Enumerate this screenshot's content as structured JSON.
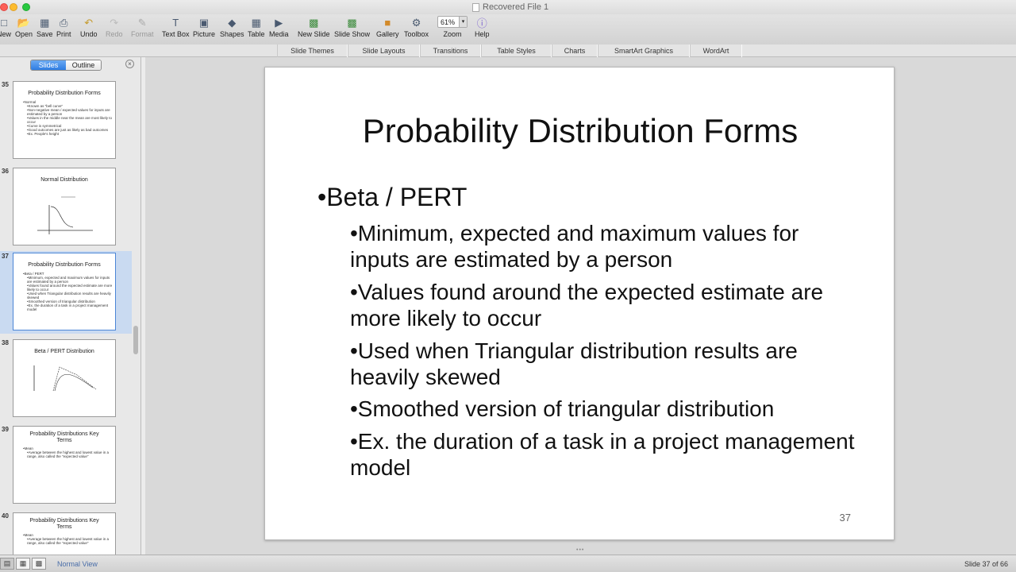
{
  "window": {
    "title": "Recovered File 1"
  },
  "toolbar": {
    "new": "New",
    "open": "Open",
    "save": "Save",
    "print": "Print",
    "undo": "Undo",
    "redo": "Redo",
    "format": "Format",
    "textbox": "Text Box",
    "picture": "Picture",
    "shapes": "Shapes",
    "table": "Table",
    "media": "Media",
    "newslide": "New Slide",
    "slideshow": "Slide Show",
    "gallery": "Gallery",
    "toolbox": "Toolbox",
    "zoom_value": "61%",
    "zoom": "Zoom",
    "help": "Help"
  },
  "ribbon": {
    "tabs": [
      "Slide Themes",
      "Slide Layouts",
      "Transitions",
      "Table Styles",
      "Charts",
      "SmartArt Graphics",
      "WordArt"
    ]
  },
  "sidebar": {
    "slides_tab": "Slides",
    "outline_tab": "Outline",
    "thumbnails": [
      {
        "num": "35",
        "title": "Probability Distribution Forms",
        "lines": [
          "•Normal",
          "•Known as \"bell curve\"",
          "•Non-negative mean / expected values for inputs are estimated by a person",
          "•Values in the middle near the mean are most likely to occur",
          "•Curve is symmetrical",
          "•Good outcomes are just as likely as bad outcomes",
          "•Ex. People's height"
        ]
      },
      {
        "num": "36",
        "title": "Normal Distribution",
        "lines": []
      },
      {
        "num": "37",
        "title": "Probability Distribution Forms",
        "lines": [
          "•Beta / PERT",
          "•Minimum, expected and maximum values for inputs are estimated by a person",
          "•Values found around the expected estimate are more likely to occur",
          "•Used when Triangular distribution results are heavily skewed",
          "•Smoothed version of triangular distribution",
          "•Ex. the duration of a task in a project management model"
        ]
      },
      {
        "num": "38",
        "title": "Beta / PERT Distribution",
        "lines": []
      },
      {
        "num": "39",
        "title": "Probability Distributions Key Terms",
        "lines": [
          "•Mean",
          "•Average between the highest and lowest value in a range, also called the \"expected value\""
        ]
      },
      {
        "num": "40",
        "title": "Probability Distributions Key Terms",
        "lines": [
          "•Mean",
          "•Average between the highest and lowest value in a range, also called the \"expected value\""
        ]
      }
    ]
  },
  "slide": {
    "title": "Probability Distribution Forms",
    "bullet": "•Beta / PERT",
    "subs": [
      "•Minimum, expected and maximum values for inputs are estimated by a person",
      "•Values found around the expected estimate are more likely to occur",
      "•Used when Triangular distribution results are heavily skewed",
      "•Smoothed version of triangular distribution",
      "•Ex. the duration of a task in a project management model"
    ],
    "number": "37"
  },
  "status": {
    "view": "Normal View",
    "slide_count": "Slide 37 of 66"
  },
  "colors": {
    "accent": "#2f7de3",
    "selection": "#c9daf1"
  }
}
